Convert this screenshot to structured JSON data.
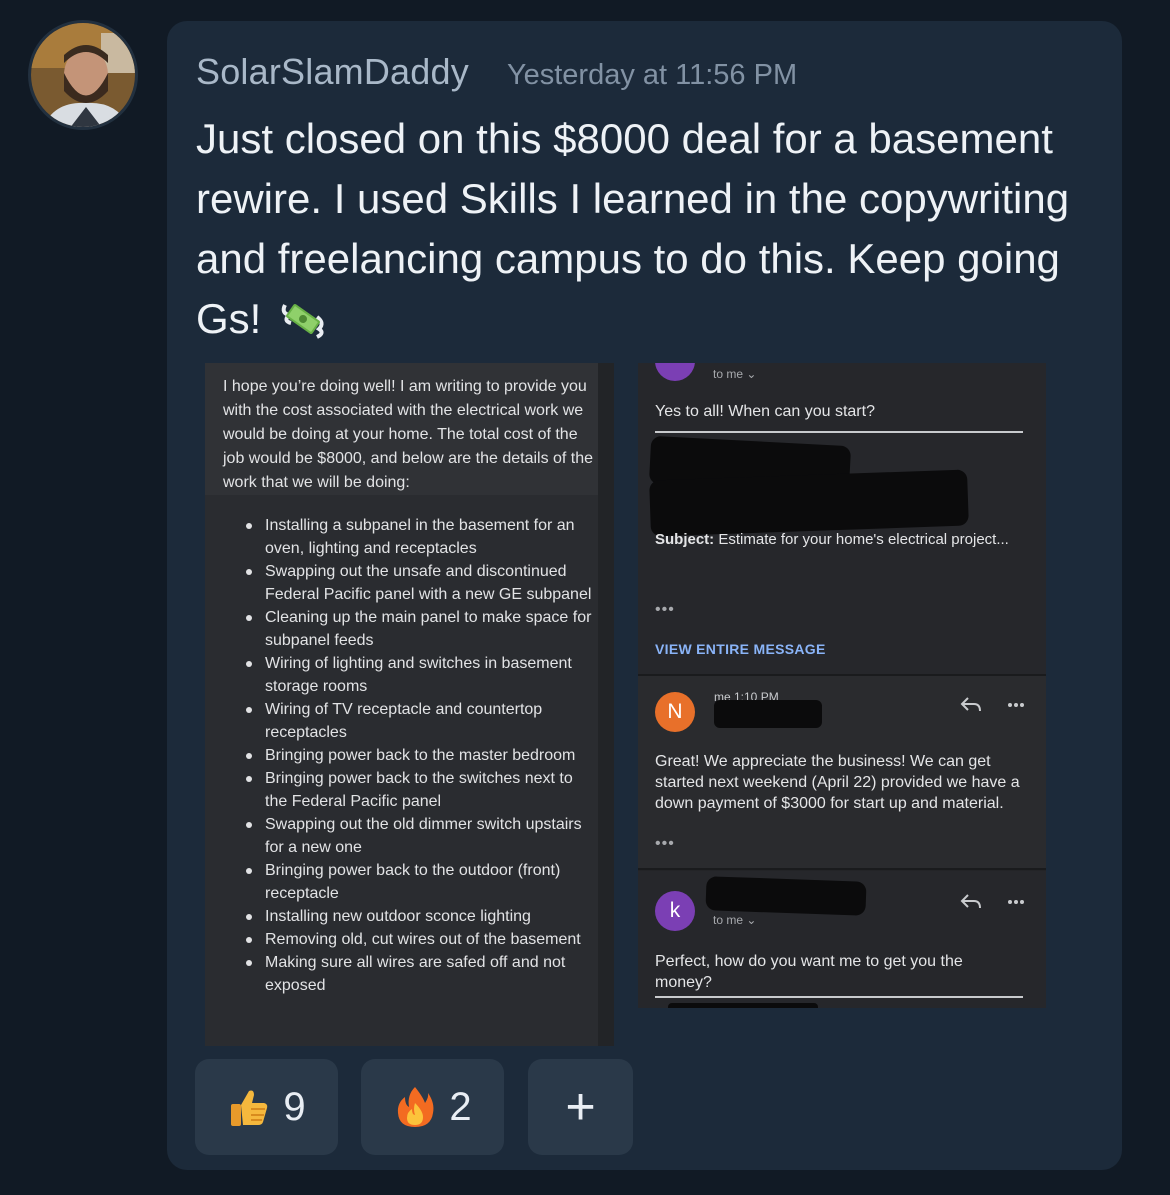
{
  "post": {
    "username": "SolarSlamDaddy",
    "timestamp": "Yesterday at 11:56 PM",
    "message": "Just closed on this $8000 deal for a basement rewire. I used Skills I learned in the copywriting and freelancing campus to do this. Keep going Gs!",
    "emoji": "money-with-wings"
  },
  "left_shot": {
    "intro": "I hope you’re doing well! I am writing to provide you with the cost associated with the electrical work we would be doing at your home. The total cost of the job would be $8000, and below are the details of the work that we will be doing:",
    "bullets": [
      "Installing a subpanel in the basement for an oven, lighting and receptacles",
      "Swapping out the unsafe and discontinued Federal Pacific panel with a new GE subpanel",
      "Cleaning up the main panel to make space for subpanel feeds",
      "Wiring of lighting and switches in basement storage rooms",
      "Wiring of TV receptacle and countertop receptacles",
      "Bringing power back to the master bedroom",
      "Bringing power back to the switches next to the Federal Pacific panel",
      "Swapping out the old dimmer switch upstairs for a new one",
      "Bringing power back to the outdoor (front) receptacle",
      "Installing new outdoor sconce lighting",
      "Removing old, cut wires out of the basement",
      "Making sure all wires are safed off and not exposed"
    ]
  },
  "right_shot": {
    "msg1": {
      "to_label": "to me ⌄",
      "body": "Yes to all!  When can you start?",
      "subject_label": "Subject:",
      "subject_text": "Estimate for your home's electrical project...",
      "ellipsis": "•••",
      "view_entire": "VIEW ENTIRE MESSAGE"
    },
    "msg2": {
      "avatar_letter": "N",
      "sender_time": "me  1:10 PM",
      "body": "Great! We appreciate the business! We can get started next weekend (April 22) provided we have a down payment of $3000 for start up and material.",
      "ellipsis": "•••"
    },
    "msg3": {
      "avatar_letter": "k",
      "to_label": "to me ⌄",
      "body": "Perfect, how do you want me to get you the money?"
    },
    "colors": {
      "avatar_k": "#7b3fb4",
      "avatar_n": "#e8702a",
      "link": "#8ab4f8"
    }
  },
  "reactions": [
    {
      "emoji": "thumbs-up",
      "count": "9"
    },
    {
      "emoji": "fire",
      "count": "2"
    },
    {
      "label": "+"
    }
  ]
}
